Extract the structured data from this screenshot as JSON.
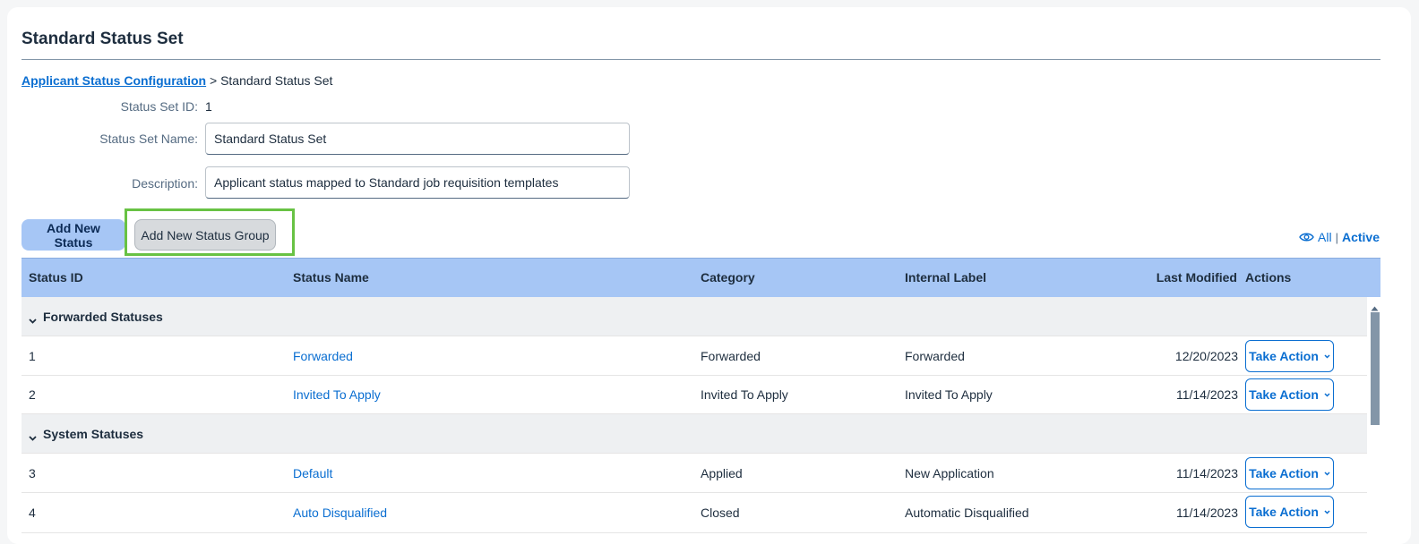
{
  "page": {
    "title": "Standard Status Set"
  },
  "breadcrumb": {
    "link": "Applicant Status Configuration",
    "separator": ">",
    "current": "Standard Status Set"
  },
  "form": {
    "id_label": "Status Set ID:",
    "id_value": "1",
    "name_label": "Status Set Name:",
    "name_value": "Standard Status Set",
    "description_label": "Description:",
    "description_value": "Applicant status mapped to Standard job requisition templates"
  },
  "toolbar": {
    "add_status_label": "Add New Status",
    "add_group_label": "Add New Status Group",
    "highlight_color": "#68c244"
  },
  "view_filter": {
    "all_label": "All",
    "separator": "|",
    "active_label": "Active",
    "icon": "eye-icon"
  },
  "table": {
    "columns": {
      "id": "Status ID",
      "name": "Status Name",
      "category": "Category",
      "internal": "Internal Label",
      "modified": "Last Modified",
      "actions": "Actions"
    },
    "groups": [
      {
        "label": "Forwarded Statuses",
        "rows": [
          {
            "id": "1",
            "name": "Forwarded",
            "category": "Forwarded",
            "internal": "Forwarded",
            "modified": "12/20/2023",
            "action": "Take Action"
          },
          {
            "id": "2",
            "name": "Invited To Apply",
            "category": "Invited To Apply",
            "internal": "Invited To Apply",
            "modified": "11/14/2023",
            "action": "Take Action"
          }
        ]
      },
      {
        "label": "System Statuses",
        "rows": [
          {
            "id": "3",
            "name": "Default",
            "category": "Applied",
            "internal": "New Application",
            "modified": "11/14/2023",
            "action": "Take Action"
          },
          {
            "id": "4",
            "name": "Auto Disqualified",
            "category": "Closed",
            "internal": "Automatic Disqualified",
            "modified": "11/14/2023",
            "action": "Take Action"
          }
        ]
      }
    ]
  },
  "colors": {
    "header_bg": "#a6c6f5",
    "link": "#0a6ed1",
    "group_bg": "#eef0f2"
  }
}
